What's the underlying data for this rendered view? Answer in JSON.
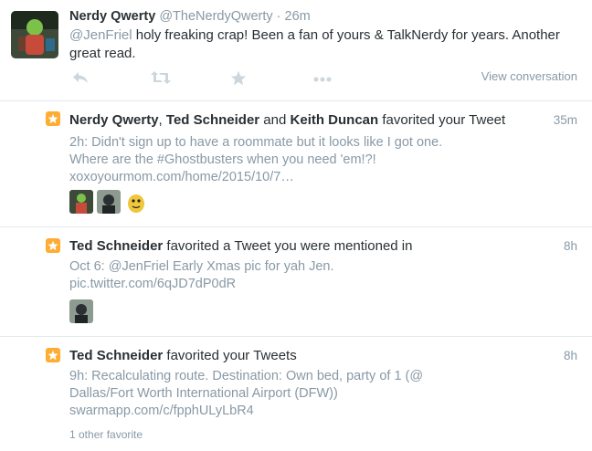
{
  "tweet": {
    "name": "Nerdy Qwerty",
    "handle": "@TheNerdyQwerty",
    "separator": "·",
    "time": "26m",
    "mention": "@JenFriel",
    "text": " holy freaking crap! Been a fan of yours & TalkNerdy for years. Another great read.",
    "actions": [
      "reply-icon",
      "retweet-icon",
      "favorite-icon",
      "more-icon"
    ],
    "view_conversation": "View conversation"
  },
  "notifications": [
    {
      "names": [
        "Nerdy Qwerty",
        "Ted Schneider",
        "Keith Duncan"
      ],
      "sep1": ", ",
      "sep2": " and ",
      "action": " favorited your Tweet",
      "time": "35m",
      "text_line1": "2h: Didn't sign up to have a roommate but it looks like I got one.",
      "text_line2_prefix": "Where are the ",
      "hashtag": "#Ghostbusters",
      "text_line2_suffix": " when you need 'em!?!",
      "text_line3": "xoxoyourmom.com/home/2015/10/7…"
    },
    {
      "name": "Ted Schneider",
      "action": " favorited a Tweet you were mentioned in",
      "time": "8h",
      "text_prefix": "Oct 6: ",
      "mention": "@JenFriel",
      "text_suffix": " Early Xmas pic for yah Jen.",
      "text_line2": "pic.twitter.com/6qJD7dP0dR"
    },
    {
      "name": "Ted Schneider",
      "action": " favorited your Tweets",
      "time": "8h",
      "text_line1": "9h: Recalculating route. Destination: Own bed, party of 1 (@",
      "text_line2": "Dallas/Fort Worth International Airport (DFW))",
      "text_line3": "swarmapp.com/c/fpphULyLbR4",
      "other": "1 other favorite"
    }
  ],
  "colors": {
    "accent_star": "#ffac33",
    "muted": "#8899a6",
    "text": "#292f33",
    "icon": "#ccd6dd"
  }
}
